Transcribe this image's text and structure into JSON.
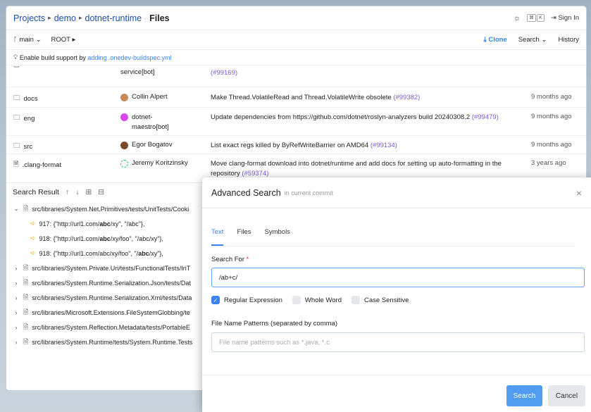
{
  "breadcrumb": {
    "projects": "Projects",
    "project": "demo",
    "repo": "dotnet-runtime",
    "current": "Files"
  },
  "topbar": {
    "kbd1": "⌘",
    "kbd2": "K",
    "signin": "Sign In"
  },
  "subbar": {
    "branch": "main",
    "path": "ROOT",
    "clone": "Clone",
    "search": "Search",
    "history": "History"
  },
  "build": {
    "prefix": "Enable build support by",
    "link": "adding .onedev-buildspec.yml"
  },
  "files": [
    {
      "name": "",
      "author": "service[bot]",
      "msg": "",
      "issue": "(#99169)",
      "date": ""
    },
    {
      "name": "docs",
      "author": "Collin Alpert",
      "msg": "Make Thread.VolatileRead and Thread.VolatileWrite obsolete",
      "issue": "(#99382)",
      "date": "9 months ago"
    },
    {
      "name": "eng",
      "author": "dotnet-maestro[bot]",
      "msg": "Update dependencies from https://github.com/dotnet/roslyn-analyzers build 20240308.2",
      "issue": "(#99479)",
      "date": "9 months ago"
    },
    {
      "name": "src",
      "author": "Egor Bogatov",
      "msg": "List exact regs killed by ByRefWriteBarrier on AMD64",
      "issue": "(#99134)",
      "date": "9 months ago"
    },
    {
      "name": ".clang-format",
      "author": "Jeremy Koritzinsky",
      "msg": "Move clang-format download into dotnet/runtime and add docs for setting up auto-formatting in the repository",
      "issue": "(#59374)",
      "date": "3 years ago"
    }
  ],
  "search_result": {
    "title": "Search Result",
    "items": [
      "src/libraries/System.Net.Primitives/tests/UnitTests/Cooki",
      "src/libraries/System.Private.Uri/tests/FunctionalTests/IriT",
      "src/libraries/System.Runtime.Serialization.Json/tests/Dat",
      "src/libraries/System.Runtime.Serialization.Xml/tests/Data",
      "src/libraries/Microsoft.Extensions.FileSystemGlobbing/te",
      "src/libraries/System.Reflection.Metadata/tests/PortableE",
      "src/libraries/System.Runtime/tests/System.Runtime.Tests"
    ],
    "matches": [
      {
        "pre": "917: {\"http://url1.com/",
        "hl": "abc",
        "post": "/xy\", \"/abc\"},"
      },
      {
        "pre": "918: {\"http://url1.com/",
        "hl": "abc",
        "post": "/xy/foo\", \"/abc/xy\"},"
      },
      {
        "pre": "918: {\"http://url1.com/abc/xy/foo\", \"/",
        "hl": "abc",
        "post": "/xy\"},"
      }
    ]
  },
  "dialog": {
    "title": "Advanced Search",
    "subtitle": "in current commit",
    "tabs": [
      "Text",
      "Files",
      "Symbols"
    ],
    "search_for_label": "Search For",
    "search_for_value": "/ab+c/",
    "regex": "Regular Expression",
    "whole_word": "Whole Word",
    "case_sensitive": "Case Sensitive",
    "patterns_label": "File Name Patterns (separated by comma)",
    "patterns_placeholder": "File name patterns such as *.java, *.c",
    "search_button": "Search",
    "cancel_button": "Cancel"
  }
}
